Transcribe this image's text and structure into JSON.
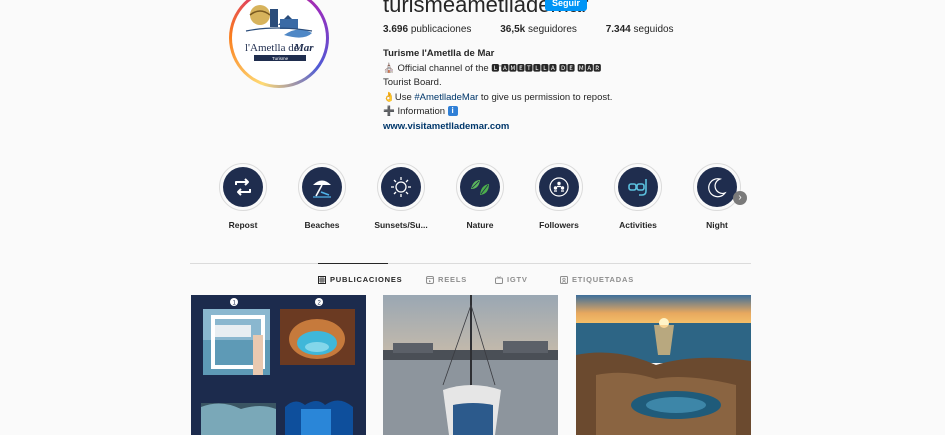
{
  "profile": {
    "username": "turismeametllademar",
    "follow_label": "Seguir",
    "stats": {
      "posts": "3.696",
      "posts_label": "publicaciones",
      "followers": "36,5k",
      "followers_label": "seguidores",
      "following": "7.344",
      "following_label": "seguidos"
    },
    "bio": {
      "full_name": "Turisme l'Ametlla de Mar",
      "line1_emoji": "⛪",
      "line1": "Official channel of the",
      "line1_brand": "🅻'🅰🅼🅴🆃🅻🅻🅰 🅳🅴 🅼🅰🆁",
      "line2": "Tourist Board.",
      "line3_emoji": "👌",
      "line3_pre": "Use",
      "line3_tag": "#AmetlladeMar",
      "line3_post": "to give us permission to repost.",
      "line4_emoji": "➕",
      "line4": "Information",
      "line4_badge": "i",
      "website": "www.visitametllademar.com"
    },
    "avatar_text": "l'Ametlla de Mar",
    "avatar_subtext": "Turisme"
  },
  "highlights": [
    {
      "label": "Repost",
      "icon": "repost-icon"
    },
    {
      "label": "Beaches",
      "icon": "beach-umbrella-icon"
    },
    {
      "label": "Sunsets/Su...",
      "icon": "sun-icon"
    },
    {
      "label": "Nature",
      "icon": "leaves-icon"
    },
    {
      "label": "Followers",
      "icon": "followers-icon"
    },
    {
      "label": "Activities",
      "icon": "snorkel-icon"
    },
    {
      "label": "Night",
      "icon": "moon-icon"
    }
  ],
  "tabs": [
    {
      "label": "PUBLICACIONES",
      "icon": "grid-icon",
      "active": true
    },
    {
      "label": "REELS",
      "icon": "reels-icon",
      "active": false
    },
    {
      "label": "IGTV",
      "icon": "igtv-icon",
      "active": false
    },
    {
      "label": "ETIQUETADAS",
      "icon": "tagged-icon",
      "active": false
    }
  ],
  "posts": [
    {
      "type": "collage",
      "badges": [
        "1",
        "2"
      ]
    },
    {
      "type": "photo",
      "subject": "harbor-sailboat"
    },
    {
      "type": "photo",
      "subject": "sunset-rocky-coast"
    }
  ],
  "colors": {
    "accent_blue": "#0095f6",
    "highlight_bg": "#1f2d4e",
    "link": "#00376b"
  }
}
